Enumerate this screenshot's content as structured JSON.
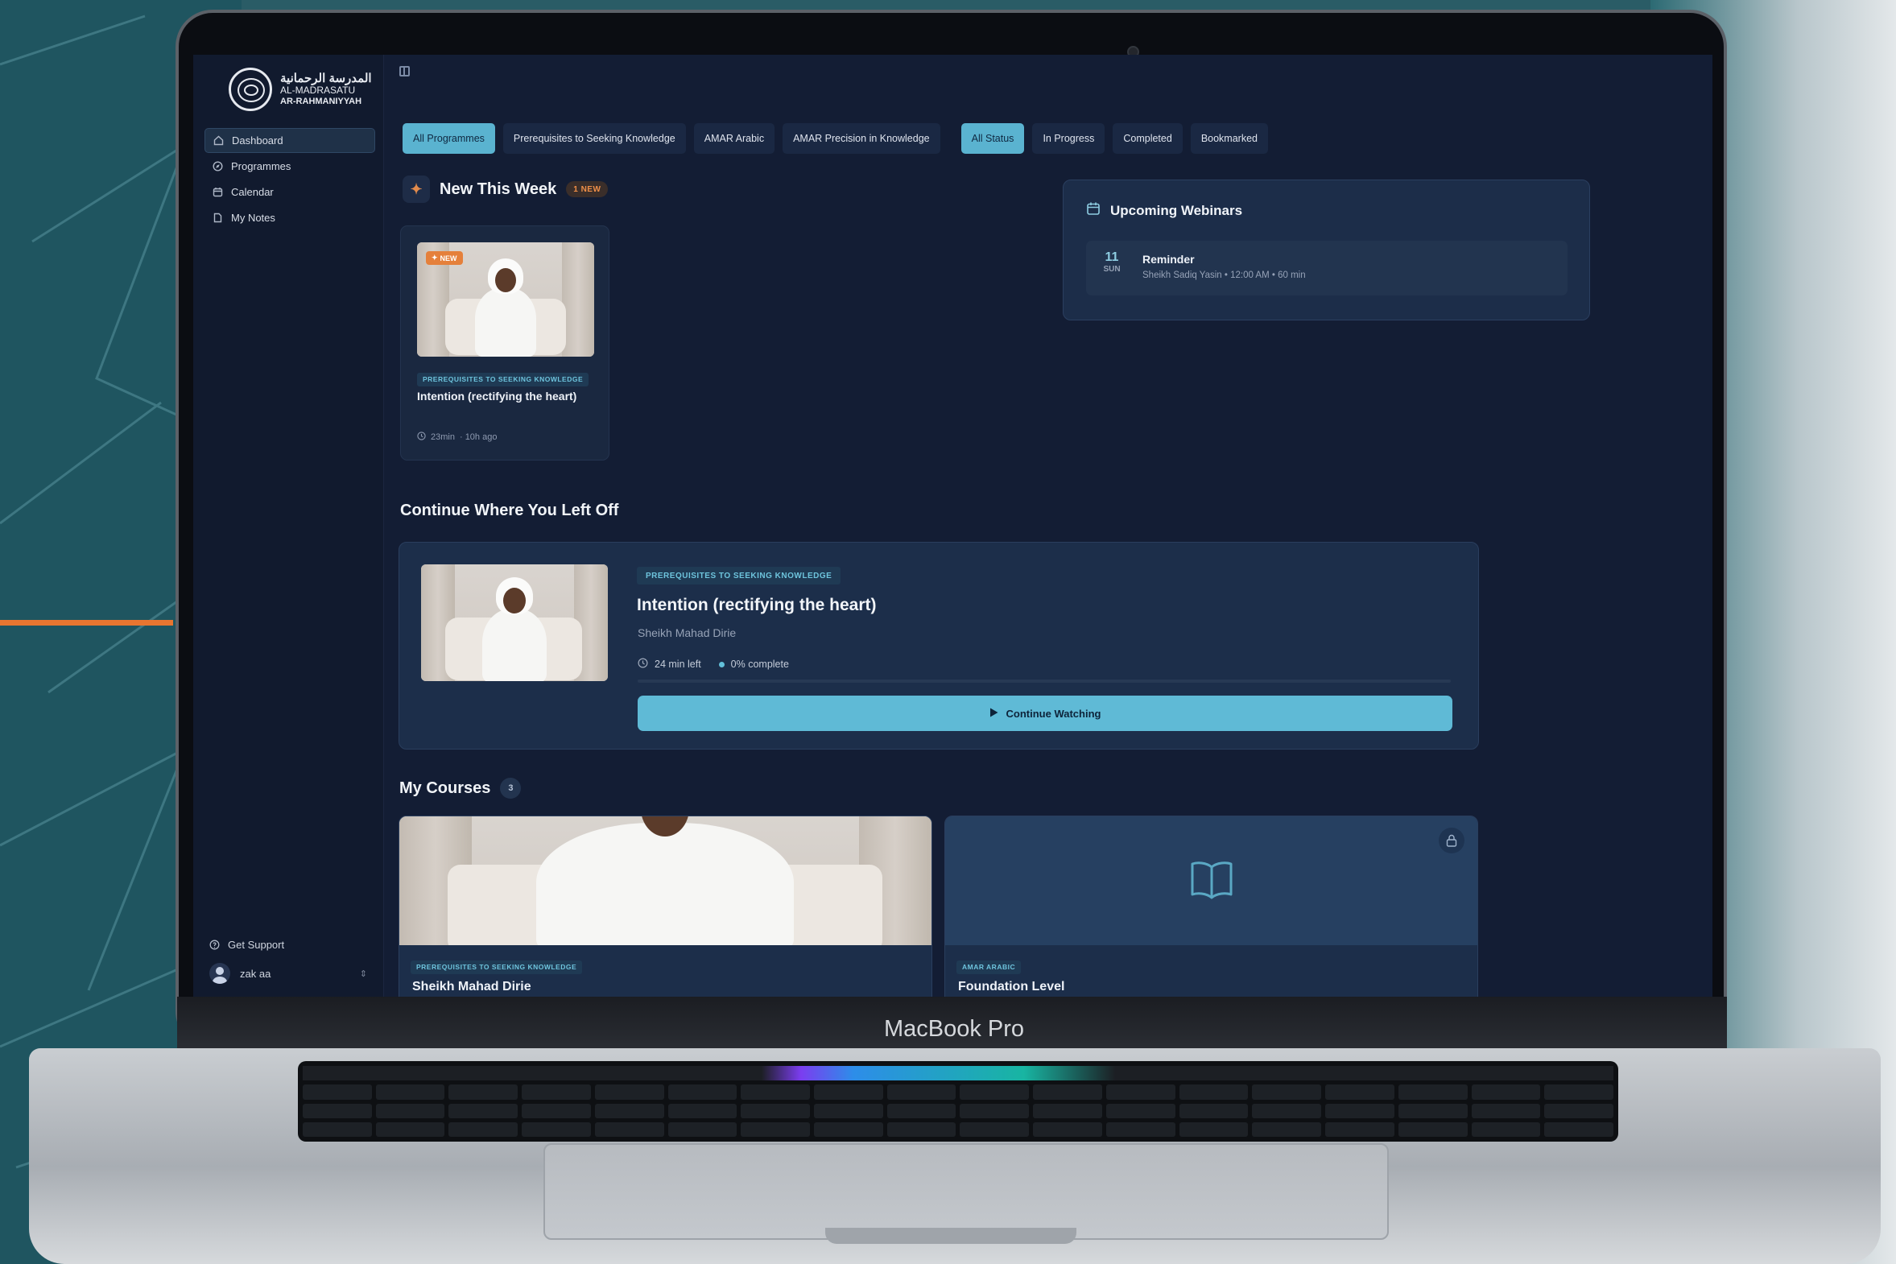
{
  "device": {
    "label": "MacBook Pro"
  },
  "app": {
    "logo": {
      "arabic": "المدرسة الرحمانية",
      "line1": "AL-MADRASATU",
      "line2": "AR-RAHMANIYYAH"
    }
  },
  "sidebar": {
    "items": [
      {
        "label": "Dashboard",
        "icon": "home-icon",
        "active": true
      },
      {
        "label": "Programmes",
        "icon": "compass-icon",
        "active": false
      },
      {
        "label": "Calendar",
        "icon": "calendar-icon",
        "active": false
      },
      {
        "label": "My Notes",
        "icon": "file-icon",
        "active": false
      }
    ],
    "support_label": "Get Support",
    "user_name": "zak aa"
  },
  "filters": {
    "programmes": [
      {
        "label": "All Programmes",
        "active": true
      },
      {
        "label": "Prerequisites to Seeking Knowledge",
        "active": false
      },
      {
        "label": "AMAR Arabic",
        "active": false
      },
      {
        "label": "AMAR Precision in Knowledge",
        "active": false
      }
    ],
    "status": [
      {
        "label": "All Status",
        "active": true
      },
      {
        "label": "In Progress",
        "active": false
      },
      {
        "label": "Completed",
        "active": false
      },
      {
        "label": "Bookmarked",
        "active": false
      }
    ]
  },
  "new_this_week": {
    "title": "New This Week",
    "badge": "1 NEW",
    "card": {
      "thumb_badge": "NEW",
      "tag": "PREREQUISITES TO SEEKING KNOWLEDGE",
      "title": "Intention (rectifying the heart)",
      "duration": "23min",
      "age": "· 10h ago"
    }
  },
  "webinars": {
    "title": "Upcoming Webinars",
    "items": [
      {
        "day": "11",
        "dow": "SUN",
        "title": "Reminder",
        "details": "Sheikh Sadiq Yasin • 12:00 AM • 60 min"
      }
    ]
  },
  "continue": {
    "title": "Continue Where You Left Off",
    "tag": "PREREQUISITES TO SEEKING KNOWLEDGE",
    "lesson_title": "Intention (rectifying the heart)",
    "author": "Sheikh Mahad Dirie",
    "time_left": "24 min left",
    "complete": "0% complete",
    "progress": 0,
    "button": "Continue Watching"
  },
  "courses": {
    "title": "My Courses",
    "count": "3",
    "items": [
      {
        "tag": "PREREQUISITES TO SEEKING KNOWLEDGE",
        "title": "Sheikh Mahad Dirie"
      },
      {
        "tag": "AMAR ARABIC",
        "title": "Foundation Level"
      }
    ]
  },
  "colors": {
    "accent": "#5fbad6",
    "background": "#131d34",
    "new_badge": "#e5803b",
    "page_accent_line": "#e77530"
  }
}
